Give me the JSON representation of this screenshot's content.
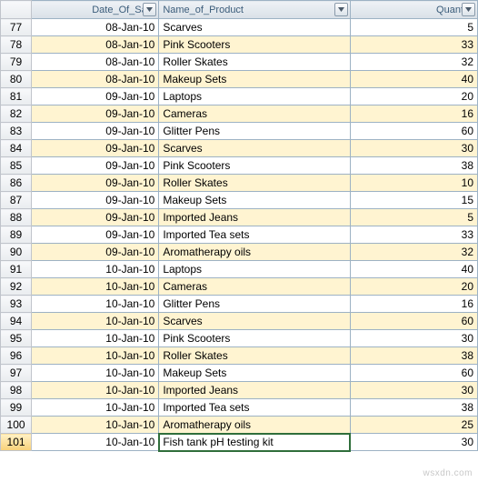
{
  "columns": {
    "date": "Date_Of_Sale",
    "product": "Name_of_Product",
    "qty": "Quantity"
  },
  "active_row": 101,
  "rows": [
    {
      "n": 77,
      "date": "08-Jan-10",
      "product": "Scarves",
      "qty": 5
    },
    {
      "n": 78,
      "date": "08-Jan-10",
      "product": "Pink Scooters",
      "qty": 33
    },
    {
      "n": 79,
      "date": "08-Jan-10",
      "product": "Roller Skates",
      "qty": 32
    },
    {
      "n": 80,
      "date": "08-Jan-10",
      "product": "Makeup Sets",
      "qty": 40
    },
    {
      "n": 81,
      "date": "09-Jan-10",
      "product": "Laptops",
      "qty": 20
    },
    {
      "n": 82,
      "date": "09-Jan-10",
      "product": "Cameras",
      "qty": 16
    },
    {
      "n": 83,
      "date": "09-Jan-10",
      "product": "Glitter Pens",
      "qty": 60
    },
    {
      "n": 84,
      "date": "09-Jan-10",
      "product": "Scarves",
      "qty": 30
    },
    {
      "n": 85,
      "date": "09-Jan-10",
      "product": "Pink Scooters",
      "qty": 38
    },
    {
      "n": 86,
      "date": "09-Jan-10",
      "product": "Roller Skates",
      "qty": 10
    },
    {
      "n": 87,
      "date": "09-Jan-10",
      "product": "Makeup Sets",
      "qty": 15
    },
    {
      "n": 88,
      "date": "09-Jan-10",
      "product": "Imported Jeans",
      "qty": 5
    },
    {
      "n": 89,
      "date": "09-Jan-10",
      "product": "Imported Tea sets",
      "qty": 33
    },
    {
      "n": 90,
      "date": "09-Jan-10",
      "product": "Aromatherapy oils",
      "qty": 32
    },
    {
      "n": 91,
      "date": "10-Jan-10",
      "product": "Laptops",
      "qty": 40
    },
    {
      "n": 92,
      "date": "10-Jan-10",
      "product": "Cameras",
      "qty": 20
    },
    {
      "n": 93,
      "date": "10-Jan-10",
      "product": "Glitter Pens",
      "qty": 16
    },
    {
      "n": 94,
      "date": "10-Jan-10",
      "product": "Scarves",
      "qty": 60
    },
    {
      "n": 95,
      "date": "10-Jan-10",
      "product": "Pink Scooters",
      "qty": 30
    },
    {
      "n": 96,
      "date": "10-Jan-10",
      "product": "Roller Skates",
      "qty": 38
    },
    {
      "n": 97,
      "date": "10-Jan-10",
      "product": "Makeup Sets",
      "qty": 60
    },
    {
      "n": 98,
      "date": "10-Jan-10",
      "product": "Imported Jeans",
      "qty": 30
    },
    {
      "n": 99,
      "date": "10-Jan-10",
      "product": "Imported Tea sets",
      "qty": 38
    },
    {
      "n": 100,
      "date": "10-Jan-10",
      "product": "Aromatherapy oils",
      "qty": 25
    },
    {
      "n": 101,
      "date": "10-Jan-10",
      "product": "Fish tank pH testing kit",
      "qty": 30
    }
  ],
  "watermark": "wsxdn.com"
}
